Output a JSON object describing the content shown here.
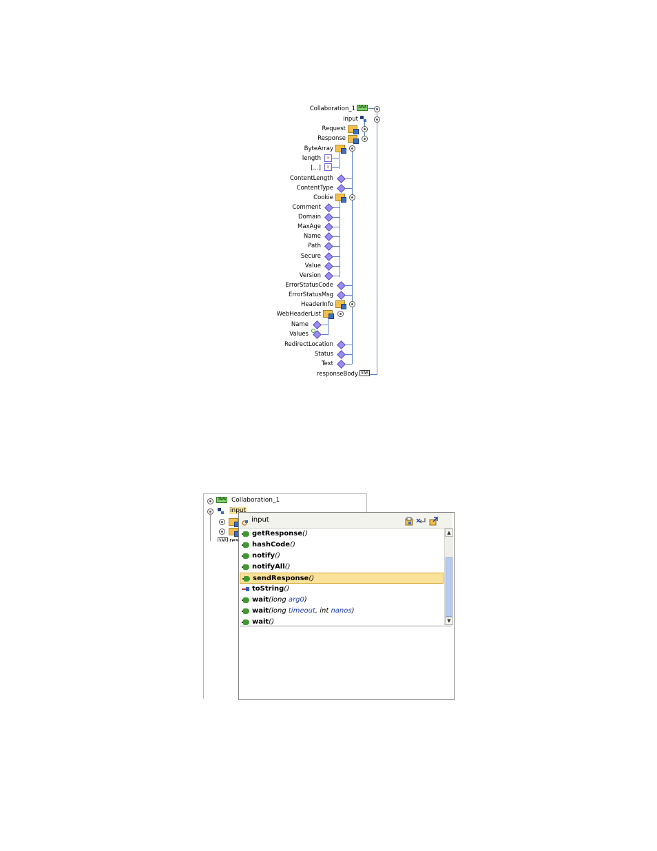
{
  "top_tree": {
    "root_label": "Collaboration_1",
    "input_label": "input",
    "request_label": "Request",
    "response_label": "Response",
    "bytearray_label": "ByteArray",
    "length_label": "length",
    "ellipsis_label": "[...]",
    "contentlength_label": "ContentLength",
    "contenttype_label": "ContentType",
    "cookie_label": "Cookie",
    "comment_label": "Comment",
    "domain_label": "Domain",
    "maxage_label": "MaxAge",
    "name_label": "Name",
    "path_label": "Path",
    "secure_label": "Secure",
    "value_label": "Value",
    "version_label": "Version",
    "errorstatuscode_label": "ErrorStatusCode",
    "errorstatusmsg_label": "ErrorStatusMsg",
    "headerinfo_label": "HeaderInfo",
    "webheaderlist_label": "WebHeaderList",
    "whl_name_label": "Name",
    "whl_values_label": "Values",
    "redirectlocation_label": "RedirectLocation",
    "status_label": "Status",
    "text_label": "Text",
    "responsebody_label": "responseBody",
    "var_icon_text": "VAR",
    "java_icon_text": "JAVA"
  },
  "bottom_tree": {
    "root_label": "Collaboration_1",
    "input_label": "input",
    "resp_label": "resp",
    "var_icon_text": "VAR",
    "java_icon_text": "JAVA"
  },
  "popup": {
    "header_title": "input",
    "items": [
      {
        "name": "getResponse",
        "sig_open": "(",
        "params": [],
        "sig_close": ")",
        "icon": "green"
      },
      {
        "name": "hashCode",
        "sig_open": "(",
        "params": [],
        "sig_close": ")",
        "icon": "green"
      },
      {
        "name": "notify",
        "sig_open": "(",
        "params": [],
        "sig_close": ")",
        "icon": "green"
      },
      {
        "name": "notifyAll",
        "sig_open": "(",
        "params": [],
        "sig_close": ")",
        "icon": "green"
      },
      {
        "name": "sendResponse",
        "sig_open": "(",
        "params": [],
        "sig_close": ")",
        "icon": "green",
        "selected": true
      },
      {
        "name": "toString",
        "sig_open": "(",
        "params": [],
        "sig_close": ")",
        "icon": "redblue"
      },
      {
        "name": "wait",
        "sig_open": "(",
        "params": [
          {
            "type": "long",
            "name": "arg0"
          }
        ],
        "sig_close": ")",
        "icon": "green"
      },
      {
        "name": "wait",
        "sig_open": "(",
        "params": [
          {
            "type": "long",
            "name": "timeout"
          },
          {
            "type": "int",
            "name": "nanos"
          }
        ],
        "sig_close": ")",
        "icon": "green"
      },
      {
        "name": "wait",
        "sig_open": "(",
        "params": [],
        "sig_close": ")",
        "icon": "green"
      }
    ]
  }
}
